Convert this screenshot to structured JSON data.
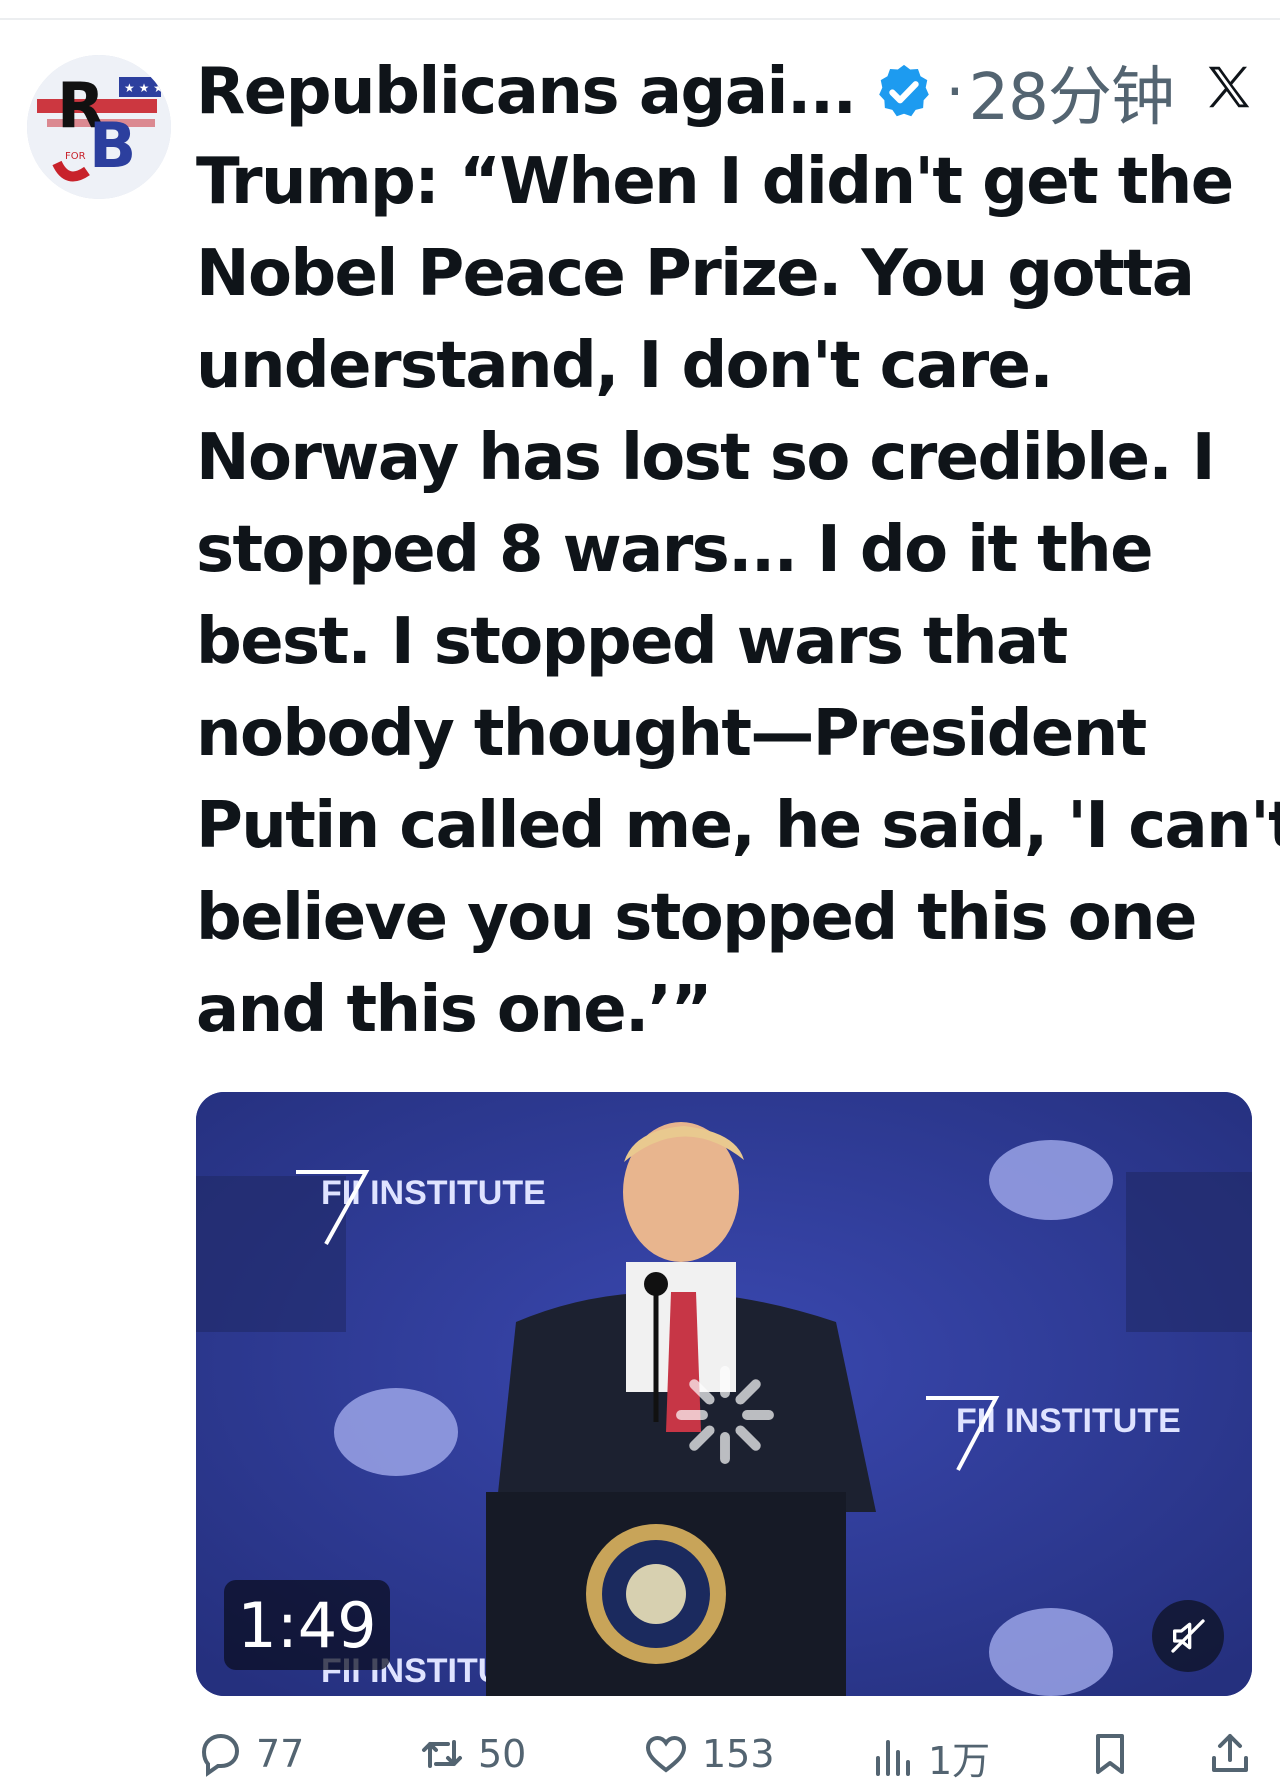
{
  "author": {
    "display_name": "Republicans agai...",
    "verified": true,
    "timestamp": "28分钟",
    "avatar_text": "RB",
    "avatar_small_text": "FOR"
  },
  "source_icon": "x-logo-icon",
  "tweet": {
    "lines": [
      "Trump: “When I didn't get the",
      "Nobel Peace Prize. You gotta",
      "understand, I don't care.",
      "Norway has lost so credible. I",
      "stopped 8 wars... I do it the",
      "best. I stopped wars that",
      "nobody thought—President",
      "Putin called me, he said, 'I can't",
      "believe you stopped this one",
      "and this one.’”"
    ]
  },
  "media": {
    "type": "video",
    "duration": "1:49",
    "backdrop_text": "FII INSTITUTE",
    "seal_text": "SEAL OF THE PRESIDENT OF THE UNITED STATES",
    "muted": true
  },
  "actions": {
    "reply_count": "77",
    "retweet_count": "50",
    "like_count": "153",
    "views_count": "1万"
  },
  "colors": {
    "text_primary": "#0f1419",
    "text_secondary": "#536471",
    "verified_blue": "#1d9bf0",
    "backdrop_blue": "#2f3c9a"
  }
}
